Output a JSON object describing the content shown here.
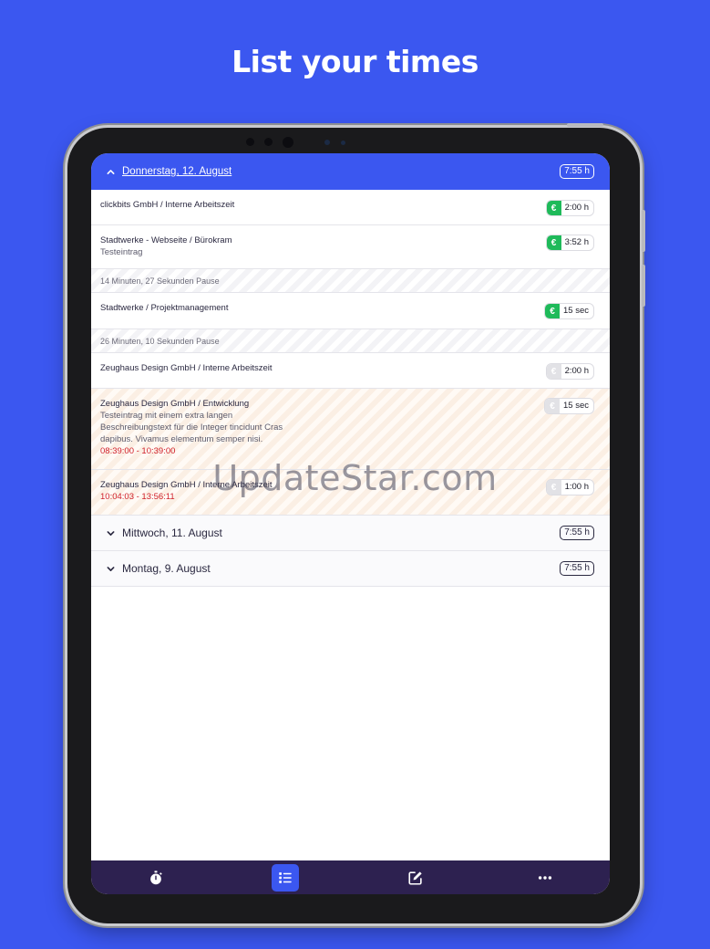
{
  "headline": "List your times",
  "days": [
    {
      "title": "Donnerstag, 12. August",
      "total": "7:55 h",
      "expanded": true
    },
    {
      "title": "Mittwoch, 11. August",
      "total": "7:55 h",
      "expanded": false
    },
    {
      "title": "Montag, 9. August",
      "total": "7:55 h",
      "expanded": false
    }
  ],
  "entries": [
    {
      "title": "clickbits GmbH / Interne Arbeitszeit",
      "duration": "2:00 h",
      "billable": true
    },
    {
      "title": "Stadtwerke - Webseite / Bürokram",
      "description": "Testeintrag",
      "duration": "3:52 h",
      "billable": true
    },
    {
      "title": "Stadtwerke / Projektmanagement",
      "duration": "15 sec",
      "billable": true
    },
    {
      "title": "Zeughaus Design GmbH / Interne Arbeitszeit",
      "duration": "2:00 h",
      "billable": false
    },
    {
      "title": "Zeughaus Design GmbH / Entwicklung",
      "description_lines": [
        "Testeintrag mit einem extra langen",
        "Beschreibungstext für die Integer tincidunt Cras",
        "dapibus. Vivamus elementum semper nisi."
      ],
      "times": "08:39:00 - 10:39:00",
      "duration": "15 sec",
      "billable": false
    },
    {
      "title": "Zeughaus Design GmbH / Interne Arbeitszeit",
      "times": "10:04:03 - 13:56:11",
      "duration": "1:00 h",
      "billable": false
    }
  ],
  "pauses": [
    "14 Minuten, 27 Sekunden Pause",
    "26 Minuten, 10 Sekunden Pause"
  ],
  "currency_symbol": "€",
  "watermark": "UpdateStar.com",
  "tabs": [
    {
      "icon": "stopwatch-icon",
      "active": false
    },
    {
      "icon": "list-icon",
      "active": true
    },
    {
      "icon": "edit-icon",
      "active": false
    },
    {
      "icon": "more-icon",
      "active": false
    }
  ],
  "colors": {
    "brand": "#3b57f0",
    "tabbar": "#2d2150",
    "billable": "#1fba5a",
    "time_range": "#d0202a"
  }
}
